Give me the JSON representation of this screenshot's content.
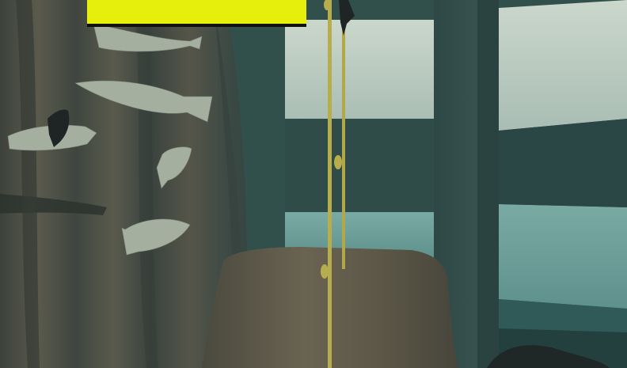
{
  "scene": {
    "name": "underwater-room",
    "colors": {
      "wall": "#2f4a47",
      "pillar": "#3a5552",
      "window_frame": "#24403e",
      "window_sky": "#c4d3c6",
      "window_sea": "#6f9f9a",
      "curtain": "#4b5147",
      "curtain_shadow": "#2d3531",
      "rock": "#5b5648",
      "kelp": "#b2a84a",
      "fish": "#a5b0a1",
      "dark_fish": "#1e2424",
      "hud": "#e6ef0b"
    },
    "objects": {
      "fish": [
        "fish-1",
        "fish-2",
        "fish-3",
        "fish-4",
        "fish-5",
        "fish-6"
      ],
      "dark_fish": [
        "dark-fish-1",
        "dark-fish-2"
      ],
      "kelp": [
        "kelp-stalk-1",
        "kelp-stalk-2"
      ]
    }
  },
  "hud": {
    "text": ""
  }
}
